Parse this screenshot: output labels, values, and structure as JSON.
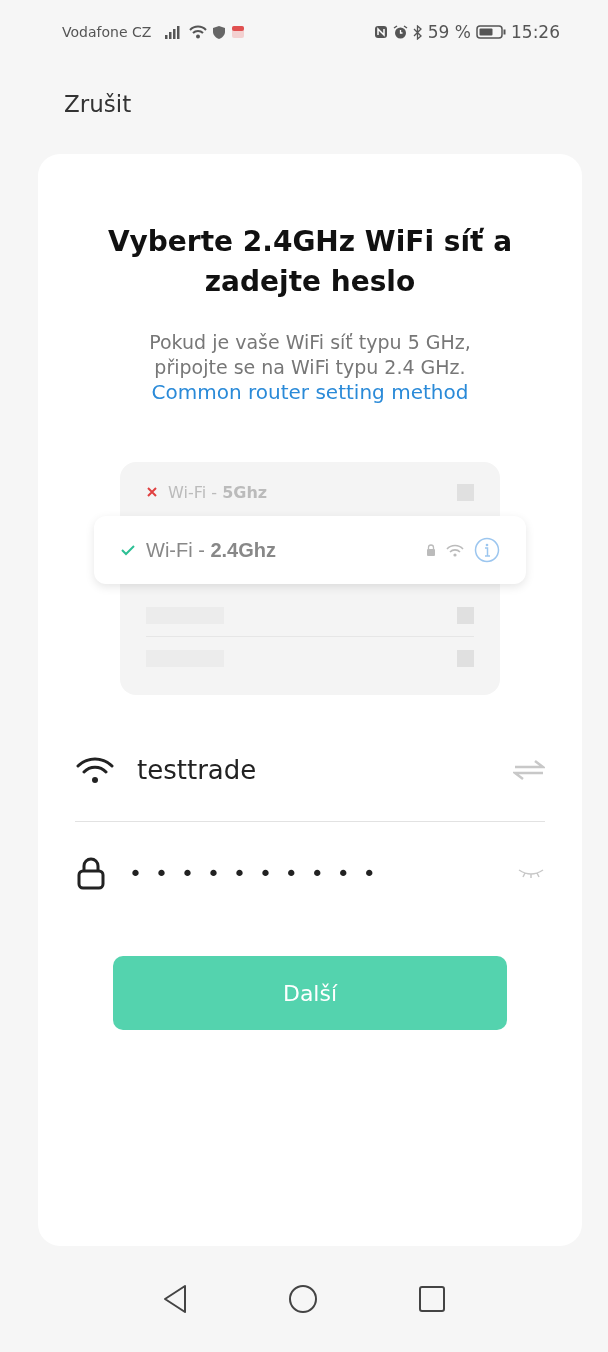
{
  "status_bar": {
    "carrier": "Vodafone CZ",
    "battery": "59 %",
    "time": "15:26"
  },
  "cancel": "Zrušit",
  "title": "Vyberte 2.4GHz WiFi síť a zadejte heslo",
  "description": "Pokud je vaše WiFi síť typu 5 GHz, připojte se na WiFi typu 2.4 GHz.",
  "link": "Common router setting method",
  "illustration": {
    "networks": [
      {
        "label": "Wi-Fi - **5Ghz**",
        "selected": false
      },
      {
        "label": "Wi-Fi - **2.4Ghz**",
        "selected": true
      }
    ]
  },
  "wifi_name": {
    "value": "testtrade"
  },
  "password": {
    "value": "••••••••••"
  },
  "next_button": "Další"
}
